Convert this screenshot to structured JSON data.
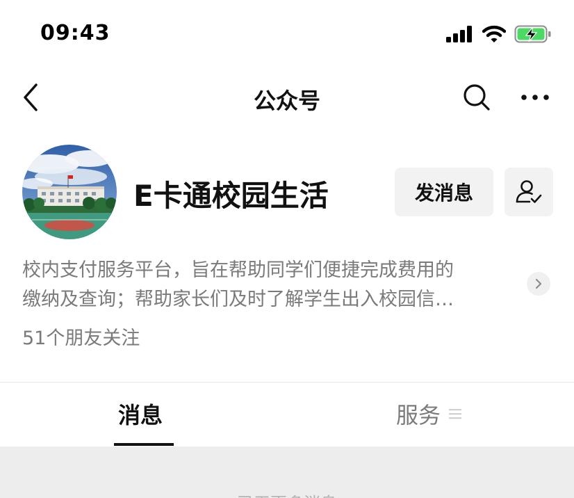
{
  "status_bar": {
    "time": "09:43",
    "icons": [
      "signal-icon",
      "wifi-icon",
      "battery-charging-icon"
    ],
    "battery_color": "#4cd964"
  },
  "nav": {
    "title": "公众号",
    "back_icon": "chevron-left-icon",
    "search_icon": "search-icon",
    "more_icon": "more-icon"
  },
  "account": {
    "name": "E卡通校园生活",
    "send_message_label": "发消息",
    "follow_icon": "user-check-icon"
  },
  "description": {
    "line1": "校内支付服务平台，旨在帮助同学们便捷完成费用的",
    "line2": "缴纳及查询；帮助家长们及时了解学生出入校园信…"
  },
  "followers_text": "51个朋友关注",
  "tabs": [
    {
      "label": "消息",
      "active": true
    },
    {
      "label": "服务",
      "active": false,
      "icon": "menu-icon"
    }
  ],
  "messages": {
    "empty_text": "已无更多消息"
  }
}
